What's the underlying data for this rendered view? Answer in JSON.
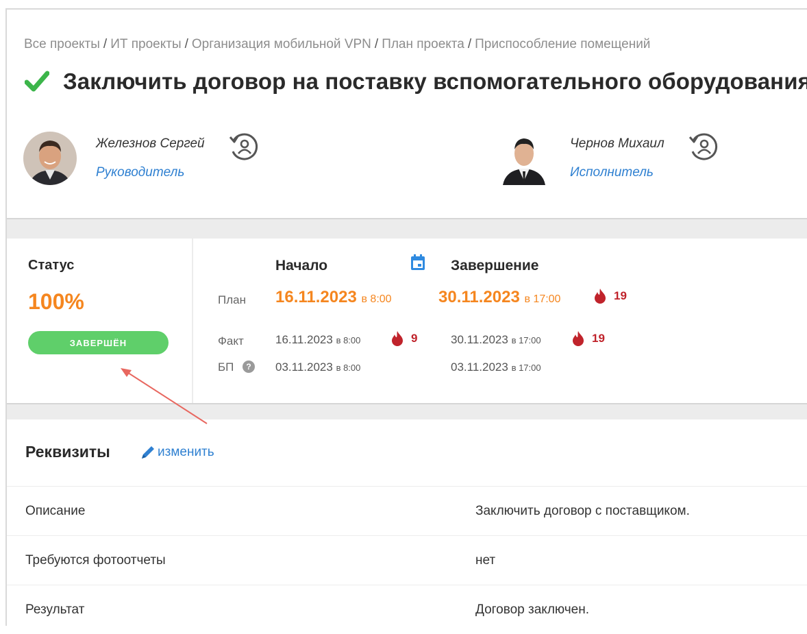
{
  "breadcrumb": {
    "items": [
      "Все проекты",
      "ИТ проекты",
      "Организация мобильной VPN",
      "План проекта",
      "Приспособление помещений"
    ],
    "separator": "/"
  },
  "task": {
    "title": "Заключить договор на поставку вспомогательного оборудования",
    "done_icon": "check-icon"
  },
  "people": [
    {
      "name": "Железнов Сергей",
      "role": "Руководитель"
    },
    {
      "name": "Чернов Михаил",
      "role": "Исполнитель"
    }
  ],
  "status": {
    "label": "Статус",
    "percent": "100%",
    "badge": "ЗАВЕРШЁН"
  },
  "dates": {
    "start_header": "Начало",
    "end_header": "Завершение",
    "plan": {
      "label": "План",
      "start_date": "16.11.2023",
      "start_time": "в 8:00",
      "end_date": "30.11.2023",
      "end_time": "в 17:00",
      "end_overdue": "19"
    },
    "fact": {
      "label": "Факт",
      "start": "16.11.2023",
      "start_time": "в 8:00",
      "start_overdue": "9",
      "end": "30.11.2023",
      "end_time": "в 17:00",
      "end_overdue": "19"
    },
    "baseline": {
      "label": "БП",
      "start": "03.11.2023",
      "start_time": "в 8:00",
      "end": "03.11.2023",
      "end_time": "в 17:00"
    }
  },
  "requisites": {
    "title": "Реквизиты",
    "edit_label": "изменить",
    "rows": [
      {
        "key": "Описание",
        "value": "Заключить договор с поставщиком."
      },
      {
        "key": "Требуются фотоотчеты",
        "value": "нет"
      },
      {
        "key": "Результат",
        "value": "Договор заключен."
      }
    ]
  },
  "colors": {
    "accent_orange": "#f5861f",
    "link_blue": "#2f80d1",
    "success_green": "#5fcf6a",
    "fire_red": "#c0232b"
  }
}
